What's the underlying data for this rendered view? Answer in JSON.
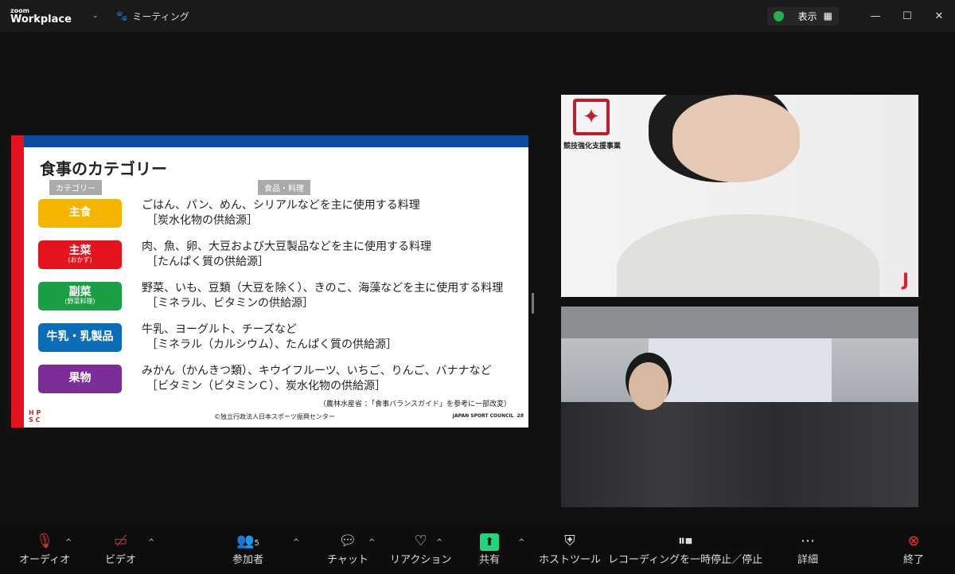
{
  "titlebar": {
    "brand_small": "zoom",
    "brand": "Workplace",
    "meeting_label": "ミーティング",
    "view_label": "表示",
    "minimize": "—",
    "maximize": "☐",
    "close": "✕"
  },
  "slide": {
    "title": "食事のカテゴリー",
    "header_category": "カテゴリー",
    "header_food": "食品・料理",
    "rows": [
      {
        "name": "主食",
        "sub": "",
        "color": "#f5b400",
        "line1": "ごはん、パン、めん、シリアルなどを主に使用する料理",
        "line2": "［炭水化物の供給源］"
      },
      {
        "name": "主菜",
        "sub": "(おかず)",
        "color": "#e5131d",
        "line1": "肉、魚、卵、大豆および大豆製品などを主に使用する料理",
        "line2": "［たんぱく質の供給源］"
      },
      {
        "name": "副菜",
        "sub": "(野菜料理)",
        "color": "#1a9f45",
        "line1": "野菜、いも、豆類（大豆を除く）、きのこ、海藻などを主に使用する料理",
        "line2": "［ミネラル、ビタミンの供給源］"
      },
      {
        "name": "牛乳・乳製品",
        "sub": "",
        "color": "#0b6db5",
        "line1": "牛乳、ヨーグルト、チーズなど",
        "line2": "［ミネラル（カルシウム）、たんぱく質の供給源］"
      },
      {
        "name": "果物",
        "sub": "",
        "color": "#7b2d98",
        "line1": "みかん（かんきつ類）、キウイフルーツ、いちご、りんご、バナナなど",
        "line2": "［ビタミン（ビタミンＣ）、炭水化物の供給源］"
      }
    ],
    "note": "（農林水産省 ：「食事バランスガイド」を参考に一部改変）",
    "copyright": "©独立行政法人日本スポーツ振興センター",
    "council": "JAPAN SPORT COUNCIL",
    "page": "28",
    "logo": "HPSC"
  },
  "video1": {
    "caption": "競技強化支援事業"
  },
  "toolbar": {
    "audio": "オーディオ",
    "video": "ビデオ",
    "participants": "参加者",
    "participants_count": "5",
    "chat": "チャット",
    "reactions": "リアクション",
    "share": "共有",
    "host_tools": "ホストツール",
    "recording": "レコーディングを一時停止／停止",
    "more": "詳細",
    "end": "終了"
  }
}
